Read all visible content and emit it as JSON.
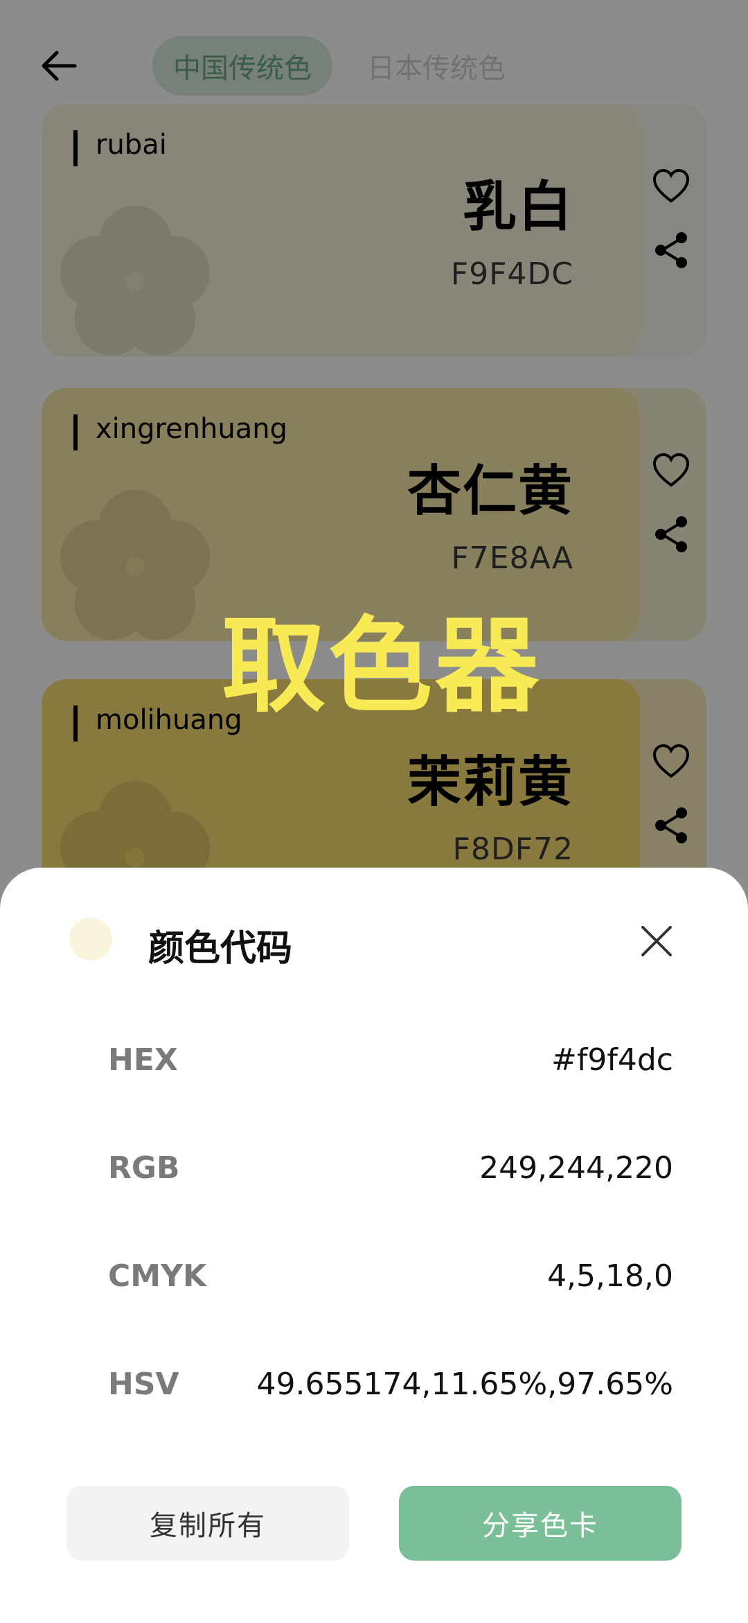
{
  "header": {
    "tabs": [
      {
        "label": "中国传统色",
        "active": true
      },
      {
        "label": "日本传统色",
        "active": false
      }
    ]
  },
  "colors": [
    {
      "pinyin": "rubai",
      "name": "乳白",
      "hex": "F9F4DC",
      "color": "#F9F4DC"
    },
    {
      "pinyin": "xingrenhuang",
      "name": "杏仁黄",
      "hex": "F7E8AA",
      "color": "#F7E8AA"
    },
    {
      "pinyin": "molihuang",
      "name": "茉莉黄",
      "hex": "F8DF72",
      "color": "#F8DF72"
    }
  ],
  "watermark": "取色器",
  "sheet": {
    "title": "颜色代码",
    "swatch_color": "#f9f4dc",
    "rows": [
      {
        "label": "HEX",
        "value": "#f9f4dc"
      },
      {
        "label": "RGB",
        "value": "249,244,220"
      },
      {
        "label": "CMYK",
        "value": "4,5,18,0"
      },
      {
        "label": "HSV",
        "value": "49.655174,11.65%,97.65%"
      }
    ],
    "copy_label": "复制所有",
    "share_label": "分享色卡"
  }
}
